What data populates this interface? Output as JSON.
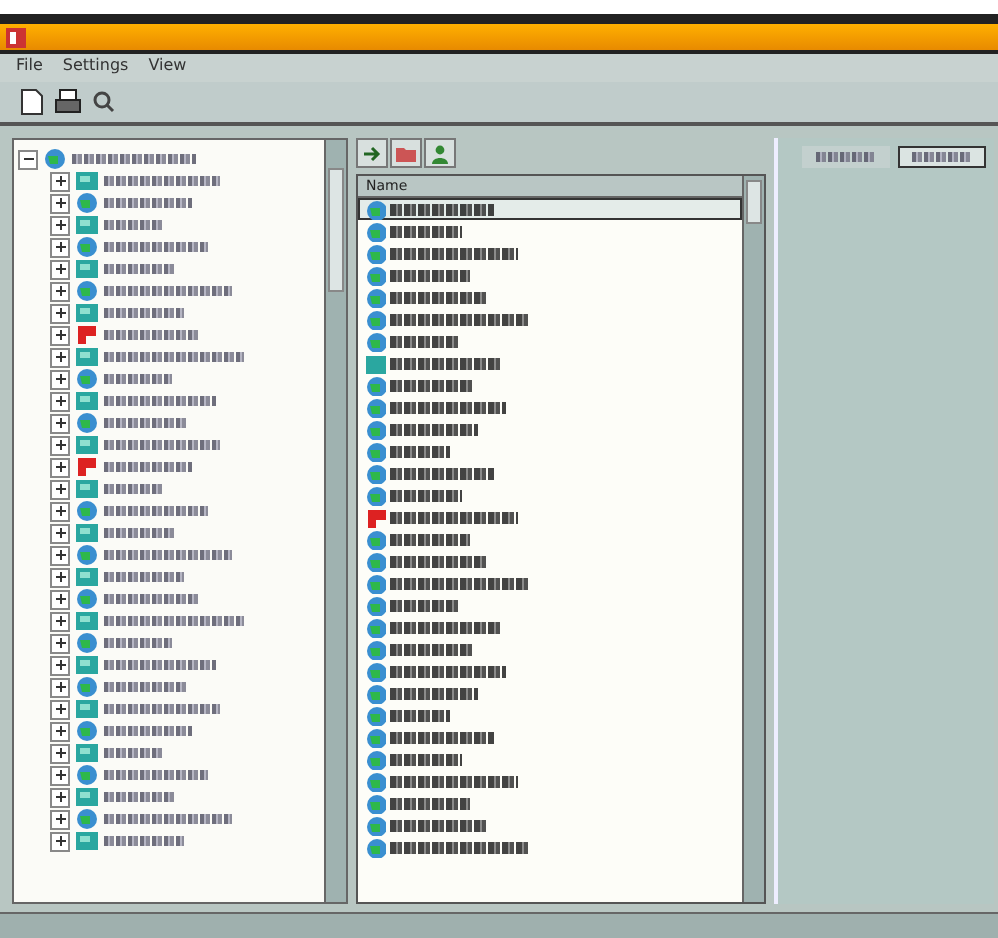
{
  "menu": [
    "File",
    "Settings",
    "View"
  ],
  "tree": {
    "root": {
      "kind": "globe",
      "expanded": true
    },
    "children": [
      {
        "kind": "tile"
      },
      {
        "kind": "globe"
      },
      {
        "kind": "tile"
      },
      {
        "kind": "globe"
      },
      {
        "kind": "tile"
      },
      {
        "kind": "globe"
      },
      {
        "kind": "tile"
      },
      {
        "kind": "alert"
      },
      {
        "kind": "tile"
      },
      {
        "kind": "globe"
      },
      {
        "kind": "tile"
      },
      {
        "kind": "globe"
      },
      {
        "kind": "tile"
      },
      {
        "kind": "alert"
      },
      {
        "kind": "tile"
      },
      {
        "kind": "globe"
      },
      {
        "kind": "tile"
      },
      {
        "kind": "globe"
      },
      {
        "kind": "tile"
      },
      {
        "kind": "globe"
      },
      {
        "kind": "tile"
      },
      {
        "kind": "globe"
      },
      {
        "kind": "tile"
      },
      {
        "kind": "globe"
      },
      {
        "kind": "tile"
      },
      {
        "kind": "globe"
      },
      {
        "kind": "tile"
      },
      {
        "kind": "globe"
      },
      {
        "kind": "tile"
      },
      {
        "kind": "globe"
      },
      {
        "kind": "tile"
      }
    ]
  },
  "list": {
    "column": "Name",
    "items": [
      {
        "kind": "globe",
        "selected": true
      },
      {
        "kind": "globe",
        "selected": false
      },
      {
        "kind": "globe",
        "selected": false
      },
      {
        "kind": "globe",
        "selected": false
      },
      {
        "kind": "globe",
        "selected": false
      },
      {
        "kind": "globe",
        "selected": false
      },
      {
        "kind": "globe",
        "selected": false
      },
      {
        "kind": "tile",
        "selected": false
      },
      {
        "kind": "globe",
        "selected": false
      },
      {
        "kind": "globe",
        "selected": false
      },
      {
        "kind": "globe",
        "selected": false
      },
      {
        "kind": "globe",
        "selected": false
      },
      {
        "kind": "globe",
        "selected": false
      },
      {
        "kind": "globe",
        "selected": false
      },
      {
        "kind": "alert",
        "selected": false
      },
      {
        "kind": "globe",
        "selected": false
      },
      {
        "kind": "globe",
        "selected": false
      },
      {
        "kind": "globe",
        "selected": false
      },
      {
        "kind": "globe",
        "selected": false
      },
      {
        "kind": "globe",
        "selected": false
      },
      {
        "kind": "globe",
        "selected": false
      },
      {
        "kind": "globe",
        "selected": false
      },
      {
        "kind": "globe",
        "selected": false
      },
      {
        "kind": "globe",
        "selected": false
      },
      {
        "kind": "globe",
        "selected": false
      },
      {
        "kind": "globe",
        "selected": false
      },
      {
        "kind": "globe",
        "selected": false
      },
      {
        "kind": "globe",
        "selected": false
      },
      {
        "kind": "globe",
        "selected": false
      },
      {
        "kind": "globe",
        "selected": false
      }
    ]
  },
  "tabs": [
    {
      "selected": false
    },
    {
      "selected": true
    }
  ]
}
